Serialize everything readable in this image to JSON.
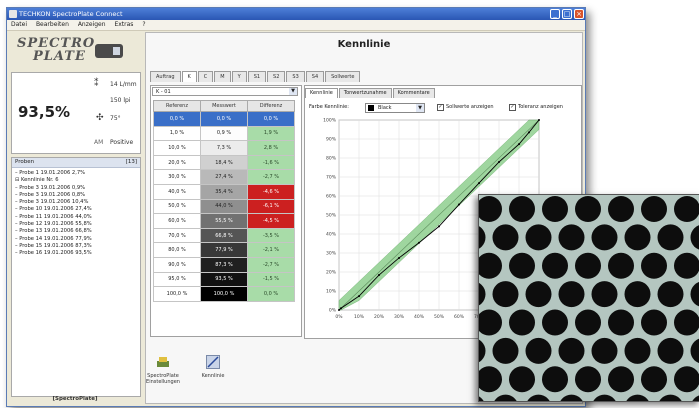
{
  "window": {
    "title": "TECHKON SpectroPlate Connect",
    "menu": [
      "Datei",
      "Bearbeiten",
      "Anzeigen",
      "Extras",
      "?"
    ],
    "buttons": {
      "minimize": "_",
      "maximize": "□",
      "close": "×"
    }
  },
  "logo": {
    "line1": "SPECTRO",
    "line2": "PLATE"
  },
  "measurement": {
    "coverage": "93,5%",
    "ruling": "14 L/mm",
    "lpi": "150 lpi",
    "angle": "75°",
    "dot_shape": "Positive",
    "am_label": "AM"
  },
  "tree": {
    "header": "Proben",
    "count": "[13]",
    "items": [
      "– Probe 1  19.01.2006  2,7%",
      "⊟ Kennlinie Nr. 6",
      "   – Probe 3  19.01.2006  0,9%",
      "   – Probe 3  19.01.2006  0,8%",
      "   – Probe 3  19.01.2006  10,4%",
      "   – Probe 10  19.01.2006  27,4%",
      "   – Probe 11  19.01.2006  44,0%",
      "   – Probe 12  19.01.2006  55,8%",
      "   – Probe 13  19.01.2006  66,8%",
      "   – Probe 14  19.01.2006  77,9%",
      "   – Probe 15  19.01.2006  87,3%",
      "   – Probe 16  19.01.2006  93,5%"
    ],
    "footer": "[SpectroPlate]"
  },
  "main": {
    "title": "Kennlinie",
    "tabs": [
      "Auftrag",
      "K",
      "C",
      "M",
      "Y",
      "S1",
      "S2",
      "S3",
      "S4",
      "Sollwerte"
    ],
    "active_tab": 1,
    "dropdown": "K - 01",
    "columns": [
      "Referenz",
      "Messwert",
      "Differenz"
    ],
    "rows": [
      {
        "ref": "0,0 %",
        "mess": "0,0 %",
        "diff": "0,0 %"
      },
      {
        "ref": "1,0 %",
        "mess": "0,9 %",
        "diff": "1,9 %"
      },
      {
        "ref": "10,0 %",
        "mess": "7,3 %",
        "diff": "2,8 %"
      },
      {
        "ref": "20,0 %",
        "mess": "18,4 %",
        "diff": "-1,6 %"
      },
      {
        "ref": "30,0 %",
        "mess": "27,4 %",
        "diff": "-2,7 %"
      },
      {
        "ref": "40,0 %",
        "mess": "35,4 %",
        "diff": "-4,6 %"
      },
      {
        "ref": "50,0 %",
        "mess": "44,0 %",
        "diff": "-6,1 %"
      },
      {
        "ref": "60,0 %",
        "mess": "55,5 %",
        "diff": "-4,5 %"
      },
      {
        "ref": "70,0 %",
        "mess": "66,8 %",
        "diff": "-3,5 %"
      },
      {
        "ref": "80,0 %",
        "mess": "77,9 %",
        "diff": "-2,1 %"
      },
      {
        "ref": "90,0 %",
        "mess": "87,3 %",
        "diff": "-2,7 %"
      },
      {
        "ref": "95,0 %",
        "mess": "93,5 %",
        "diff": "-1,5 %"
      },
      {
        "ref": "100,0 %",
        "mess": "100,0 %",
        "diff": "0,0 %"
      }
    ],
    "chart_tabs": [
      "Kennlinie",
      "Tonwertzunahme",
      "Kommentare"
    ],
    "farbe_label": "Farbe Kennlinie:",
    "farbe_value": "Black",
    "check_soll": "Sollwerte anzeigen",
    "check_tol": "Toleranz anzeigen",
    "bottom_icons": [
      {
        "label1": "SpectroPlate",
        "label2": "Einstellungen"
      },
      {
        "label1": "Kennlinie",
        "label2": ""
      }
    ]
  },
  "chart_data": {
    "type": "line",
    "x": [
      0,
      1,
      10,
      20,
      30,
      40,
      50,
      60,
      70,
      80,
      90,
      95,
      100
    ],
    "series": [
      {
        "values": [
          0,
          0.9,
          7.3,
          18.4,
          27.4,
          35.4,
          44.0,
          55.5,
          66.8,
          77.9,
          87.3,
          93.5,
          100
        ]
      }
    ],
    "xlim": [
      0,
      100
    ],
    "ylim": [
      0,
      100
    ],
    "xticks": [
      "0%",
      "10%",
      "20%",
      "30%",
      "40%",
      "50%",
      "60%",
      "70%",
      "80%",
      "90%",
      "100%"
    ],
    "yticks": [
      "0%",
      "10%",
      "20%",
      "30%",
      "40%",
      "50%",
      "60%",
      "70%",
      "80%",
      "90%",
      "100%"
    ],
    "grid": true,
    "tolerance_band_color": "#8fd08f",
    "line_color": "#000000"
  }
}
